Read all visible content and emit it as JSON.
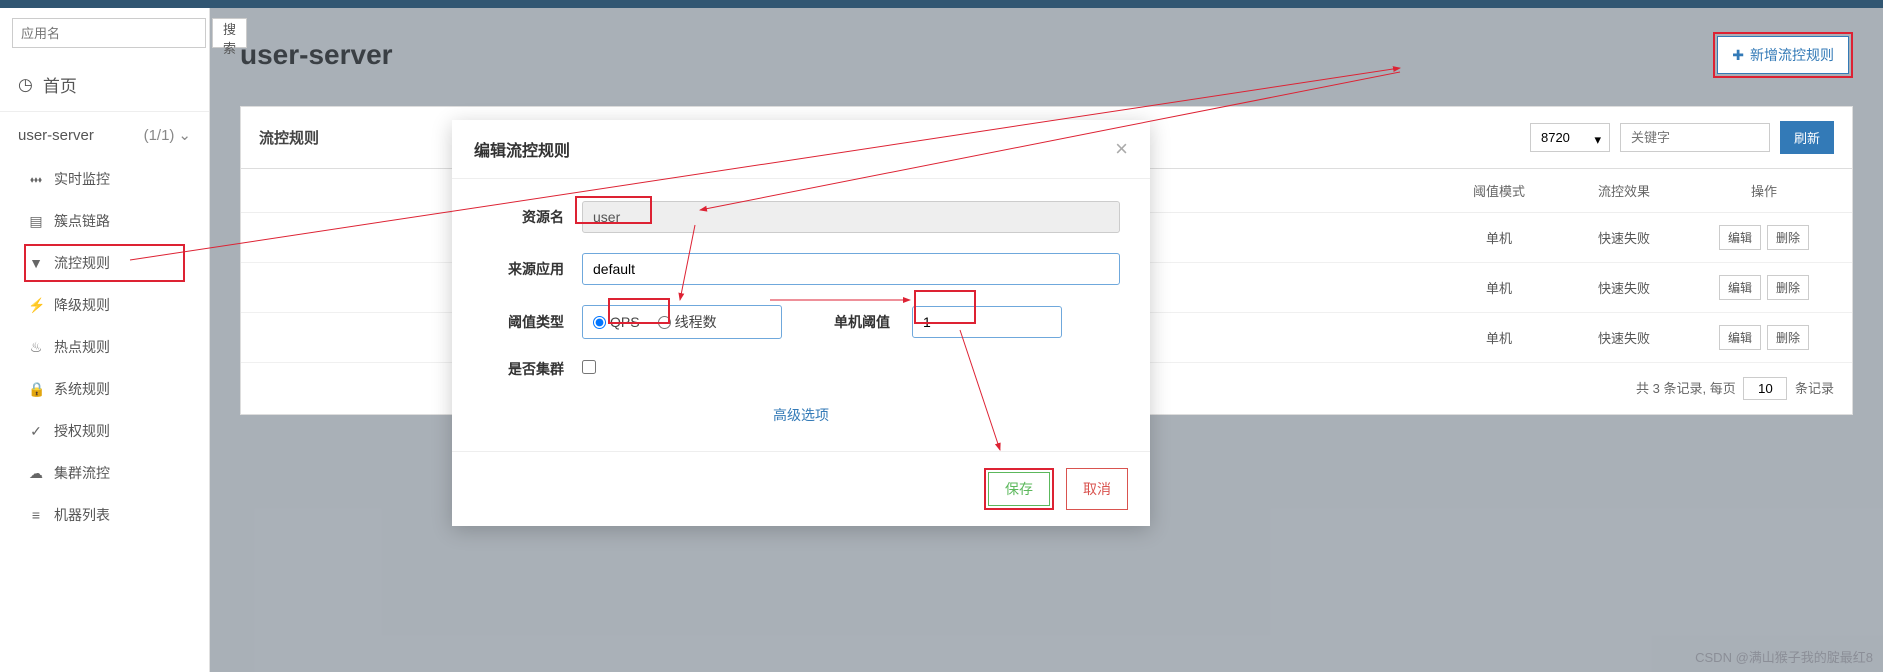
{
  "sidebar": {
    "search_placeholder": "应用名",
    "search_btn": "搜索",
    "home": "首页",
    "app_name": "user-server",
    "app_count": "(1/1)",
    "items": [
      {
        "icon": "chart-icon",
        "label": "实时监控"
      },
      {
        "icon": "list-icon",
        "label": "簇点链路"
      },
      {
        "icon": "filter-icon",
        "label": "流控规则"
      },
      {
        "icon": "bolt-icon",
        "label": "降级规则"
      },
      {
        "icon": "fire-icon",
        "label": "热点规则"
      },
      {
        "icon": "lock-icon",
        "label": "系统规则"
      },
      {
        "icon": "check-icon",
        "label": "授权规则"
      },
      {
        "icon": "cloud-icon",
        "label": "集群流控"
      },
      {
        "icon": "server-icon",
        "label": "机器列表"
      }
    ]
  },
  "main": {
    "title": "user-server",
    "add_btn": "新增流控规则",
    "panel_title": "流控规则",
    "port_select": "8720",
    "keyword_placeholder": "关键字",
    "refresh": "刷新",
    "columns": {
      "mode": "阈值模式",
      "effect": "流控效果",
      "actions": "操作"
    },
    "rows": [
      {
        "mode": "单机",
        "effect": "快速失败"
      },
      {
        "mode": "单机",
        "effect": "快速失败"
      },
      {
        "mode": "单机",
        "effect": "快速失败"
      }
    ],
    "edit_btn": "编辑",
    "delete_btn": "删除",
    "pager_prefix": "共 3 条记录, 每页",
    "pager_size": "10",
    "pager_suffix": "条记录"
  },
  "modal": {
    "title": "编辑流控规则",
    "labels": {
      "resource": "资源名",
      "source": "来源应用",
      "type": "阈值类型",
      "threshold": "单机阈值",
      "cluster": "是否集群"
    },
    "resource_value": "user",
    "source_value": "default",
    "radio_qps": "QPS",
    "radio_thread": "线程数",
    "threshold_value": "1",
    "advanced": "高级选项",
    "save": "保存",
    "cancel": "取消"
  },
  "watermark": "CSDN @满山猴子我的腚最红8"
}
